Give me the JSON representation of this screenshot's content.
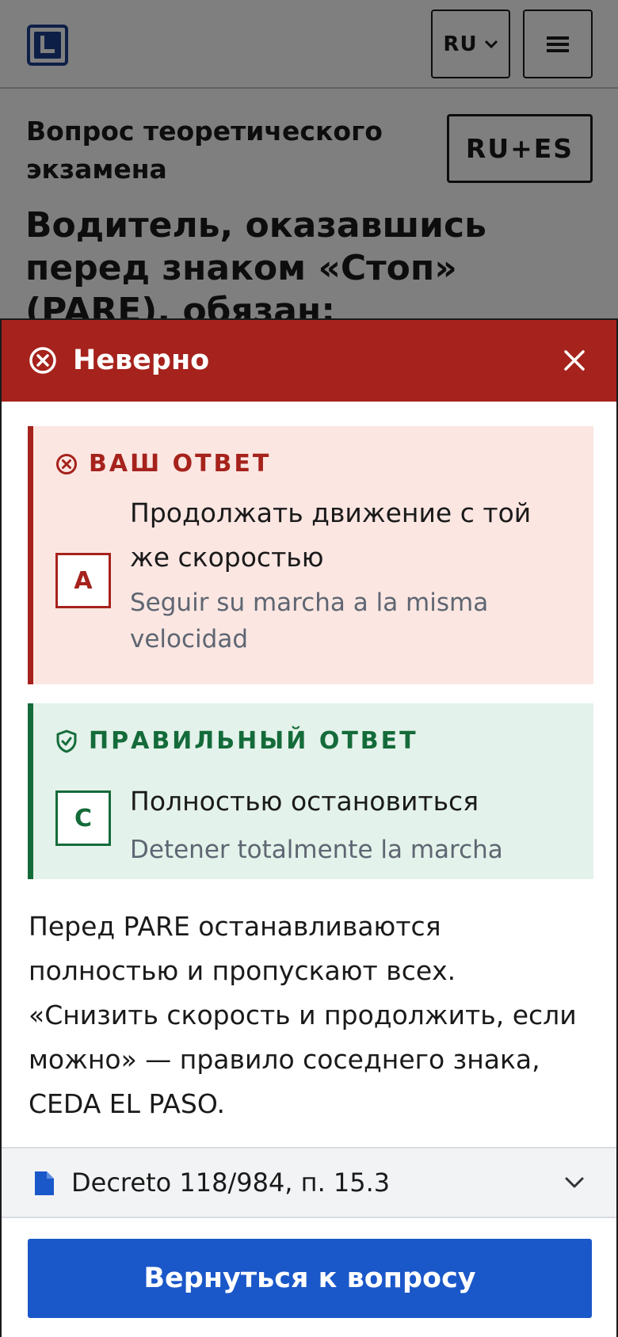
{
  "header": {
    "logo_name": "license-L-logo",
    "language_label": "RU",
    "menu_icon": "hamburger-icon"
  },
  "question": {
    "kicker": "Вопрос теоретического экзамена",
    "mode_label": "RU+ES",
    "text": "Водитель, оказавшись перед знаком «Стоп» (PARE), обязан:"
  },
  "feedback": {
    "title": "Неверно",
    "status_color": "#a6221c",
    "your_answer": {
      "label": "ВАШ ОТВЕТ",
      "letter": "A",
      "text_ru": "Продолжать движение с той же скоростью",
      "text_es": "Seguir su marcha a la misma velocidad"
    },
    "correct_answer": {
      "label": "ПРАВИЛЬНЫЙ ОТВЕТ",
      "letter": "C",
      "text_ru": "Полностью остановиться",
      "text_es": "Detener totalmente la marcha",
      "color": "#146b3a"
    },
    "explanation": "Перед PARE останавливаются полностью и пропускают всех. «Снизить скорость и продолжить, если можно» — правило соседнего знака, CEDA EL PASO.",
    "source": "Decreto 118/984, п. 15.3",
    "back_button": "Вернуться к вопросу",
    "accent_color": "#1a57c9"
  }
}
